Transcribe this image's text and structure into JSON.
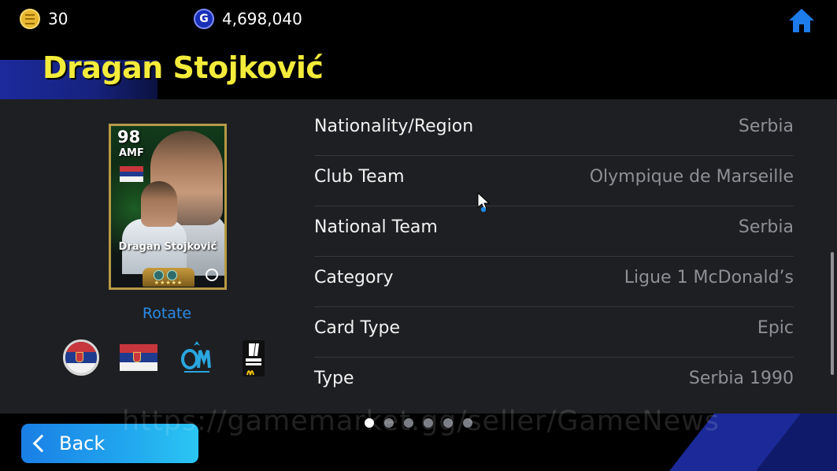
{
  "currency": {
    "coins": "30",
    "gp": "4,698,040",
    "coin_icon": "efootball-coin-icon",
    "gp_icon": "gp-icon",
    "gp_symbol": "G"
  },
  "header": {
    "home_icon": "home-icon",
    "player_name": "Dragan Stojković"
  },
  "card": {
    "rating": "98",
    "position": "AMF",
    "name": "Dragan Stojković",
    "stars": "★★★★★"
  },
  "rotate_label": "Rotate",
  "badges": [
    "serbia-round-flag-icon",
    "serbia-flag-icon",
    "olympique-de-marseille-logo",
    "ligue-1-mcdonalds-logo"
  ],
  "info_rows": [
    {
      "label": "Nationality/Region",
      "value": "Serbia"
    },
    {
      "label": "Club Team",
      "value": "Olympique de Marseille"
    },
    {
      "label": "National Team",
      "value": "Serbia"
    },
    {
      "label": "Category",
      "value": "Ligue 1 McDonald’s"
    },
    {
      "label": "Card Type",
      "value": "Epic"
    },
    {
      "label": "Type",
      "value": "Serbia 1990"
    }
  ],
  "footer": {
    "back_label": "Back",
    "page_count": 6,
    "active_page": 1,
    "watermark": "https://gamemarket.gg/seller/GameNews"
  },
  "colors": {
    "name_yellow": "#f3ec3a",
    "accent_blue": "#2b8ae6",
    "panel": "#1e1f22"
  }
}
